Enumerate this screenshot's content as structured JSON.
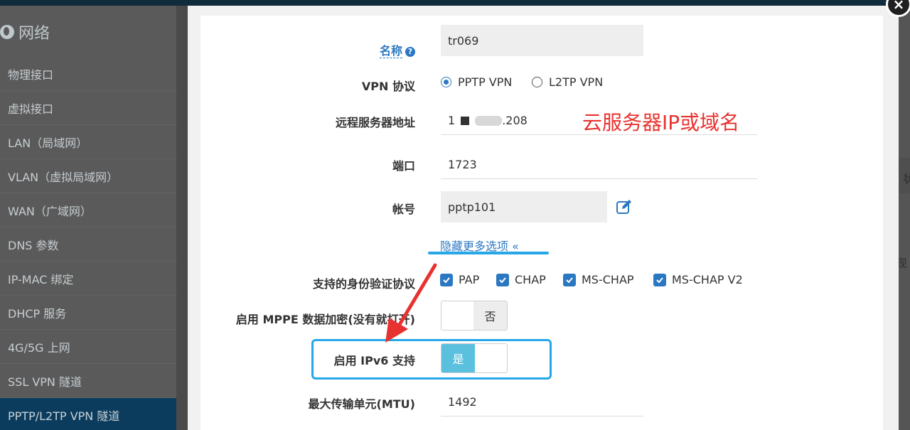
{
  "sidebar": {
    "title": "网络",
    "items": [
      {
        "label": "物理接口",
        "active": false
      },
      {
        "label": "虚拟接口",
        "active": false
      },
      {
        "label": "LAN（局域网）",
        "active": false
      },
      {
        "label": "VLAN（虚拟局域网）",
        "active": false
      },
      {
        "label": "WAN（广域网）",
        "active": false
      },
      {
        "label": "DNS 参数",
        "active": false
      },
      {
        "label": "IP-MAC 绑定",
        "active": false
      },
      {
        "label": "DHCP 服务",
        "active": false
      },
      {
        "label": "4G/5G 上网",
        "active": false
      },
      {
        "label": "SSL VPN 隧道",
        "active": false
      },
      {
        "label": "PPTP/L2TP VPN 隧道",
        "active": true
      }
    ]
  },
  "right_fragments": {
    "top": "状",
    "bottom": "现"
  },
  "modal": {
    "close_icon": "×",
    "name": {
      "label": "名称",
      "help": "?",
      "value": "tr069"
    },
    "vpn_protocol": {
      "label": "VPN 协议",
      "options": [
        {
          "label": "PPTP VPN",
          "selected": true
        },
        {
          "label": "L2TP VPN",
          "selected": false
        }
      ]
    },
    "server": {
      "label": "远程服务器地址",
      "value_prefix": "1",
      "value_suffix": ".208"
    },
    "annotation": "云服务器IP或域名",
    "port": {
      "label": "端口",
      "value": "1723"
    },
    "account": {
      "label": "帐号",
      "value": "pptp101",
      "icon": "edit-icon"
    },
    "more_options": "隐藏更多选项 «",
    "auth": {
      "label": "支持的身份验证协议",
      "options": [
        {
          "label": "PAP",
          "checked": true
        },
        {
          "label": "CHAP",
          "checked": true
        },
        {
          "label": "MS-CHAP",
          "checked": true
        },
        {
          "label": "MS-CHAP V2",
          "checked": true
        }
      ]
    },
    "mppe": {
      "label": "启用 MPPE 数据加密(没有就打开)",
      "toggle_label": "否",
      "enabled": false
    },
    "ipv6": {
      "label": "启用 IPv6 支持",
      "toggle_label": "是",
      "enabled": true
    },
    "mtu": {
      "label": "最大传输单元(MTU)",
      "value": "1492"
    }
  },
  "colors": {
    "accent": "#2b78c2",
    "highlight": "#27a7e7",
    "annotation": "#e8322f",
    "toggle_on": "#5bc0de"
  }
}
